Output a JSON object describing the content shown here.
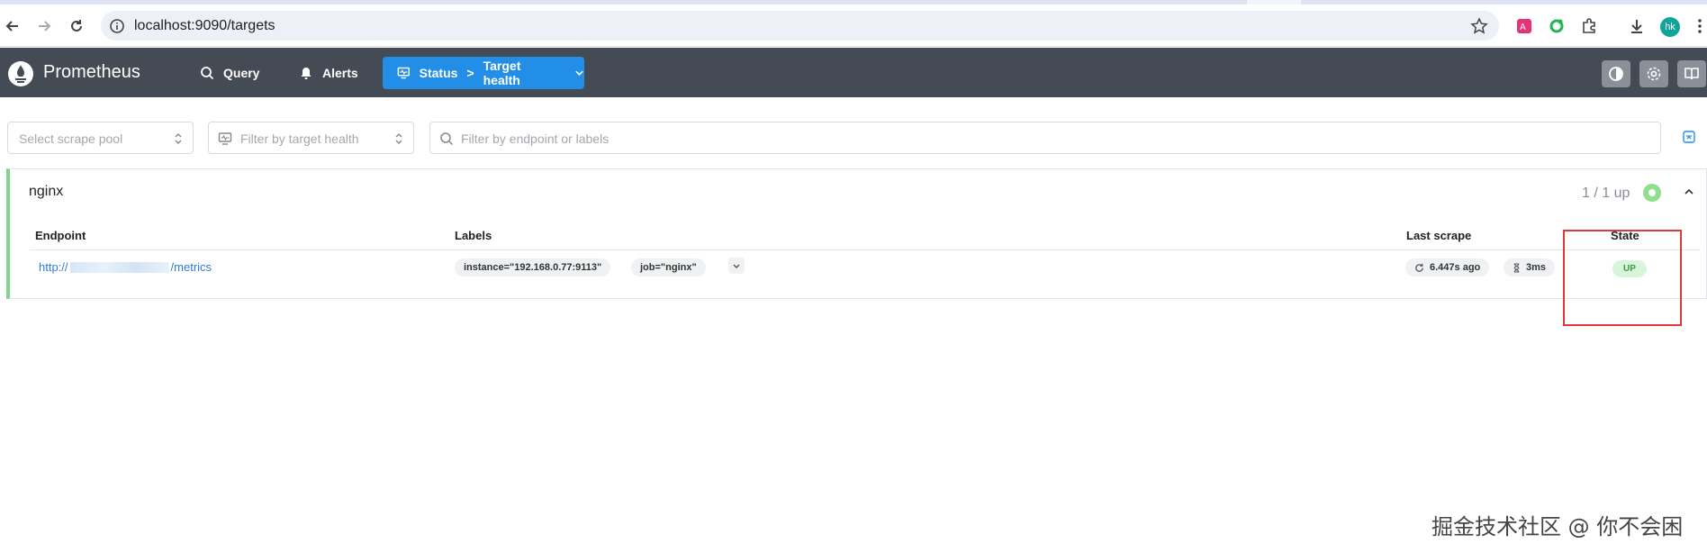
{
  "browser": {
    "url": "localhost:9090/targets",
    "profile_initials": "hk"
  },
  "app": {
    "brand": "Prometheus",
    "nav": {
      "query": "Query",
      "alerts": "Alerts",
      "status": "Status",
      "status_sep": ">",
      "status_page": "Target health"
    }
  },
  "filters": {
    "scrape_pool_placeholder": "Select scrape pool",
    "health_placeholder": "Filter by target health",
    "endpoint_placeholder": "Filter by endpoint or labels"
  },
  "pool": {
    "name": "nginx",
    "count": "1 / 1 up",
    "columns": {
      "endpoint": "Endpoint",
      "labels": "Labels",
      "last_scrape": "Last scrape",
      "state": "State"
    },
    "rows": [
      {
        "endpoint_prefix": "http://",
        "endpoint_suffix": "/metrics",
        "labels": [
          "instance=\"192.168.0.77:9113\"",
          "job=\"nginx\""
        ],
        "last_scrape": "6.447s ago",
        "duration": "3ms",
        "state": "UP"
      }
    ]
  },
  "watermark": "掘金技术社区 @ 你不会困",
  "colors": {
    "header_bg": "#444b54",
    "accent": "#238ee8",
    "up_green": "#3f9a48",
    "pool_border": "#7fd58a",
    "highlight": "#e23a3a"
  }
}
